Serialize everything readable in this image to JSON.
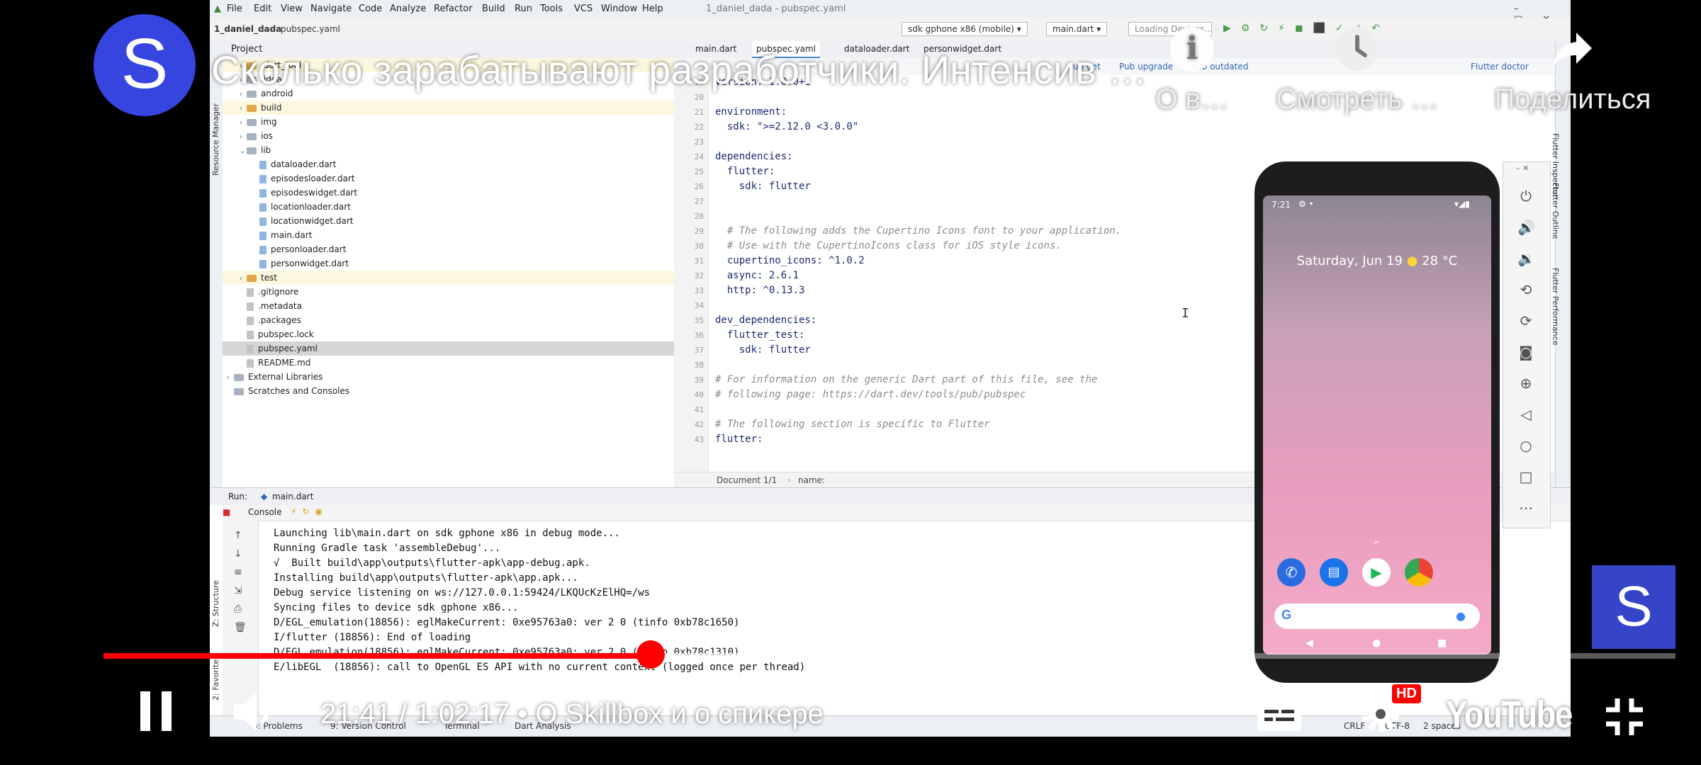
{
  "ide": {
    "window_title": "1_daniel_dada - pubspec.yaml",
    "menu": [
      "File",
      "Edit",
      "View",
      "Navigate",
      "Code",
      "Analyze",
      "Refactor",
      "Build",
      "Run",
      "Tools",
      "VCS",
      "Window",
      "Help"
    ],
    "project_name": "1_daniel_dada",
    "open_file": "pubspec.yaml",
    "device_selector": "sdk gphone x86 (mobile)",
    "run_config": "main.dart",
    "loading_text": "Loading Devices...",
    "project_panel_label": "Project",
    "tabs": [
      "main.dart",
      "pubspec.yaml",
      "dataloader.dart",
      "personwidget.dart"
    ],
    "pub_actions": [
      "Pub get",
      "Pub upgrade",
      "Pub outdated",
      "Flutter doctor"
    ],
    "left_strip_label": "Resource Manager",
    "right_strip_labels": [
      "Flutter Inspector",
      "Flutter Outline",
      "Flutter Performance"
    ],
    "tree": [
      {
        "label": ".dart_tool",
        "kind": "folder-org",
        "depth": 1,
        "caret": "›",
        "style": "hl"
      },
      {
        "label": ".idea",
        "kind": "folder",
        "depth": 1,
        "caret": "›",
        "style": ""
      },
      {
        "label": "android",
        "kind": "folder",
        "depth": 1,
        "caret": "›",
        "style": ""
      },
      {
        "label": "build",
        "kind": "folder-org",
        "depth": 1,
        "caret": "›",
        "style": "hl"
      },
      {
        "label": "img",
        "kind": "folder",
        "depth": 1,
        "caret": "›",
        "style": ""
      },
      {
        "label": "ios",
        "kind": "folder",
        "depth": 1,
        "caret": "›",
        "style": ""
      },
      {
        "label": "lib",
        "kind": "folder",
        "depth": 1,
        "caret": "⌄",
        "style": ""
      },
      {
        "label": "dataloader.dart",
        "kind": "file",
        "depth": 2,
        "caret": "",
        "style": ""
      },
      {
        "label": "episodesloader.dart",
        "kind": "file",
        "depth": 2,
        "caret": "",
        "style": ""
      },
      {
        "label": "episodeswidget.dart",
        "kind": "file",
        "depth": 2,
        "caret": "",
        "style": ""
      },
      {
        "label": "locationloader.dart",
        "kind": "file",
        "depth": 2,
        "caret": "",
        "style": ""
      },
      {
        "label": "locationwidget.dart",
        "kind": "file",
        "depth": 2,
        "caret": "",
        "style": ""
      },
      {
        "label": "main.dart",
        "kind": "file",
        "depth": 2,
        "caret": "",
        "style": ""
      },
      {
        "label": "personloader.dart",
        "kind": "file",
        "depth": 2,
        "caret": "",
        "style": ""
      },
      {
        "label": "personwidget.dart",
        "kind": "file",
        "depth": 2,
        "caret": "",
        "style": ""
      },
      {
        "label": "test",
        "kind": "folder-org",
        "depth": 1,
        "caret": "›",
        "style": "hl"
      },
      {
        "label": ".gitignore",
        "kind": "file-gray",
        "depth": 1,
        "caret": "",
        "style": ""
      },
      {
        "label": ".metadata",
        "kind": "file-gray",
        "depth": 1,
        "caret": "",
        "style": ""
      },
      {
        "label": ".packages",
        "kind": "file-gray",
        "depth": 1,
        "caret": "",
        "style": ""
      },
      {
        "label": "pubspec.lock",
        "kind": "file-gray",
        "depth": 1,
        "caret": "",
        "style": ""
      },
      {
        "label": "pubspec.yaml",
        "kind": "file-gray",
        "depth": 1,
        "caret": "",
        "style": "sel"
      },
      {
        "label": "README.md",
        "kind": "file-gray",
        "depth": 1,
        "caret": "",
        "style": ""
      },
      {
        "label": "External Libraries",
        "kind": "folder",
        "depth": 0,
        "caret": "›",
        "style": ""
      },
      {
        "label": "Scratches and Consoles",
        "kind": "folder",
        "depth": 0,
        "caret": "",
        "style": ""
      }
    ],
    "code_lines": [
      {
        "n": "19",
        "text": "version: 1.0.0+1",
        "cls": "key"
      },
      {
        "n": "20",
        "text": "",
        "cls": ""
      },
      {
        "n": "21",
        "text": "environment:",
        "cls": "key"
      },
      {
        "n": "22",
        "text": "  sdk: \">=2.12.0 <3.0.0\"",
        "cls": "key"
      },
      {
        "n": "23",
        "text": "",
        "cls": ""
      },
      {
        "n": "24",
        "text": "dependencies:",
        "cls": "key"
      },
      {
        "n": "25",
        "text": "  flutter:",
        "cls": "key"
      },
      {
        "n": "26",
        "text": "    sdk: flutter",
        "cls": "key"
      },
      {
        "n": "27",
        "text": "",
        "cls": ""
      },
      {
        "n": "28",
        "text": "",
        "cls": ""
      },
      {
        "n": "29",
        "text": "  # The following adds the Cupertino Icons font to your application.",
        "cls": "cmt"
      },
      {
        "n": "30",
        "text": "  # Use with the CupertinoIcons class for iOS style icons.",
        "cls": "cmt"
      },
      {
        "n": "31",
        "text": "  cupertino_icons: ^1.0.2",
        "cls": "key"
      },
      {
        "n": "32",
        "text": "  async: 2.6.1",
        "cls": "key"
      },
      {
        "n": "33",
        "text": "  http: ^0.13.3",
        "cls": "key"
      },
      {
        "n": "34",
        "text": "",
        "cls": ""
      },
      {
        "n": "35",
        "text": "dev_dependencies:",
        "cls": "key"
      },
      {
        "n": "36",
        "text": "  flutter_test:",
        "cls": "key"
      },
      {
        "n": "37",
        "text": "    sdk: flutter",
        "cls": "key"
      },
      {
        "n": "38",
        "text": "",
        "cls": ""
      },
      {
        "n": "39",
        "text": "# For information on the generic Dart part of this file, see the",
        "cls": "cmt"
      },
      {
        "n": "40",
        "text": "# following page: https://dart.dev/tools/pub/pubspec",
        "cls": "cmt"
      },
      {
        "n": "41",
        "text": "",
        "cls": ""
      },
      {
        "n": "42",
        "text": "# The following section is specific to Flutter",
        "cls": "cmt"
      },
      {
        "n": "43",
        "text": "flutter:",
        "cls": "key"
      }
    ],
    "breadcrumb": [
      "Document 1/1",
      "name:"
    ],
    "run_label": "Run:",
    "run_tab": "main.dart",
    "console_label": "Console",
    "console_lines": [
      "Launching lib\\main.dart on sdk gphone x86 in debug mode...",
      "Running Gradle task 'assembleDebug'...",
      "√  Built build\\app\\outputs\\flutter-apk\\app-debug.apk.",
      "Installing build\\app\\outputs\\flutter-apk\\app.apk...",
      "Debug service listening on ws://127.0.0.1:59424/LKQUcKzElHQ=/ws",
      "Syncing files to device sdk gphone x86...",
      "D/EGL_emulation(18856): eglMakeCurrent: 0xe95763a0: ver 2 0 (tinfo 0xb78c1650)",
      "I/flutter (18856): End of loading",
      "D/EGL_emulation(18856): eglMakeCurrent: 0xe95763a0: ver 2 0 (tinfo 0xb78c1310)",
      "E/libEGL  (18856): call to OpenGL ES API with no current context (logged once per thread)"
    ],
    "side_labels": [
      "Z: Structure",
      "2: Favorites"
    ],
    "bottom_tabs": [
      "6: Problems",
      "9: Version Control",
      "Terminal",
      "Dart Analysis"
    ],
    "status_right": [
      "CRLF",
      "UTF-8",
      "2 spaces"
    ],
    "phone": {
      "status_time": "7:21",
      "date_widget": "Saturday, Jun 19",
      "temperature": "28 °C"
    }
  },
  "youtube": {
    "channel_initial": "S",
    "video_title": "Сколько зарабатывают разработчики. Интенсив …",
    "actions": [
      {
        "label": "О в…",
        "icon": "info-icon"
      },
      {
        "label": "Смотреть …",
        "icon": "clock-icon"
      },
      {
        "label": "Поделиться",
        "icon": "share-icon"
      }
    ],
    "current_time": "21:41",
    "duration": "1:02:17",
    "chapter": "О Skillbox и о спикере",
    "played_fraction": 0.348,
    "buffered_fraction": 0.61,
    "hd_badge": "HD",
    "logo": "YouTube",
    "accent_color": "#ff0000"
  }
}
